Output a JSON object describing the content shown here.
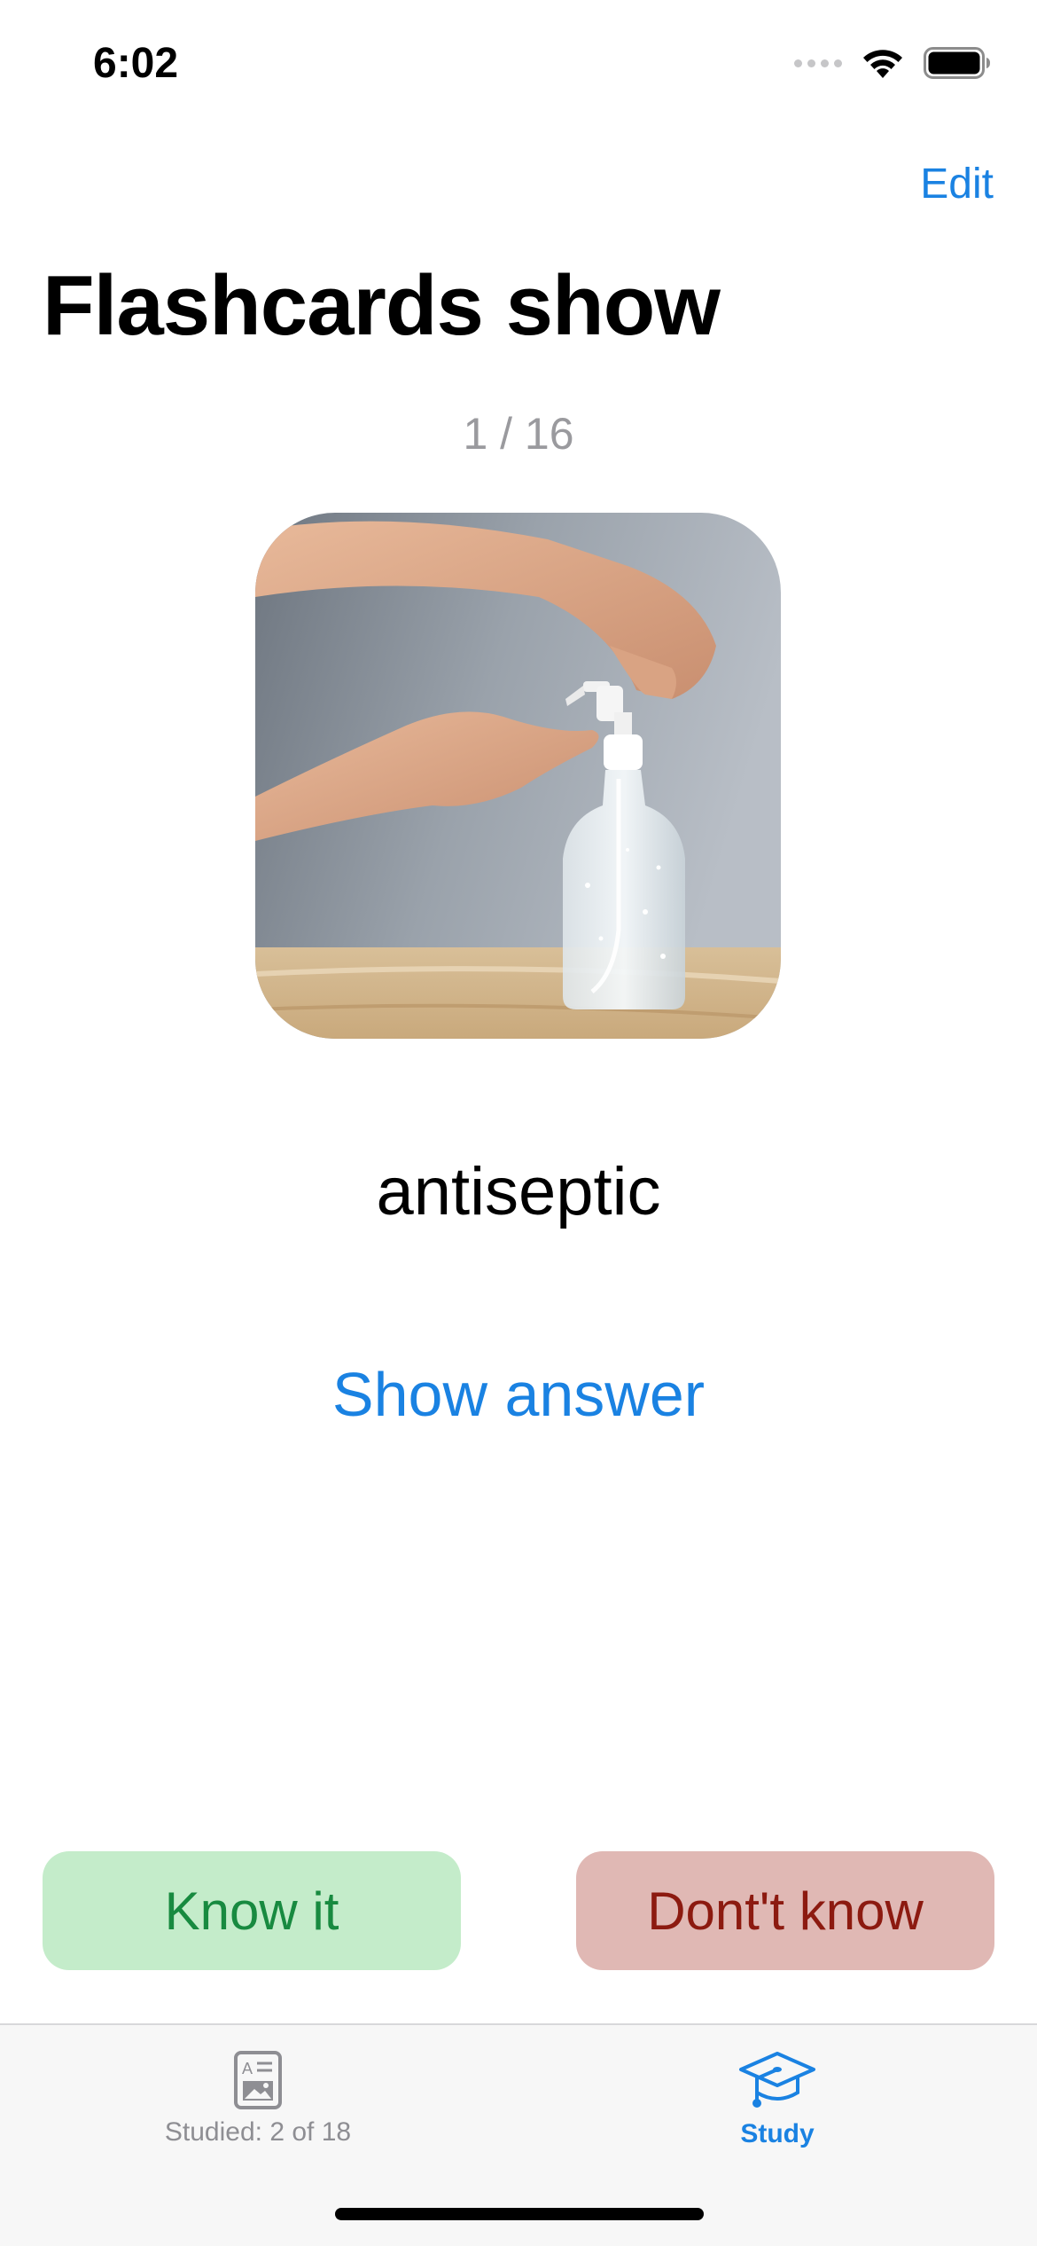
{
  "status_bar": {
    "time": "6:02"
  },
  "nav": {
    "edit_label": "Edit",
    "title": "Flashcards show"
  },
  "card": {
    "counter": "1 / 16",
    "image_description_icon": "hand-sanitizer-photo",
    "word": "antiseptic",
    "show_answer_label": "Show answer"
  },
  "actions": {
    "know_label": "Know it",
    "dont_know_label": "Dont't know"
  },
  "tab_bar": {
    "tabs": [
      {
        "label": "Studied: 2 of 18",
        "icon": "flashcard-icon",
        "selected": false
      },
      {
        "label": "Study",
        "icon": "graduation-cap-icon",
        "selected": true
      }
    ]
  },
  "colors": {
    "accent": "#1a82e2",
    "know_bg": "#c4ecca",
    "know_text": "#188a40",
    "dont_bg": "#e0b8b4",
    "dont_text": "#8c1a10"
  }
}
